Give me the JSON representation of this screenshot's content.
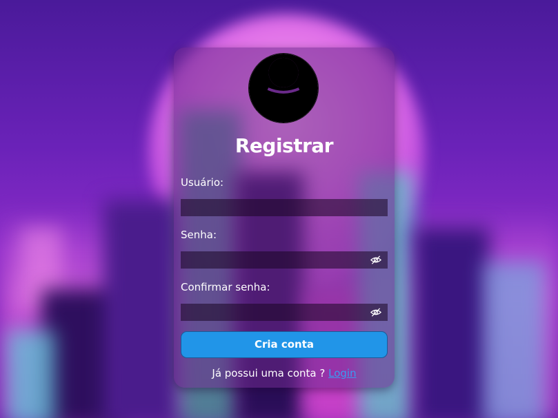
{
  "form": {
    "title": "Registrar",
    "username_label": "Usuário:",
    "username_value": "",
    "password_label": "Senha:",
    "password_value": "",
    "confirm_label": "Confirmar senha:",
    "confirm_value": "",
    "submit_label": "Cria conta",
    "footer_text": "Já possui uma conta ? ",
    "login_link": "Login",
    "toggle_icon": "eye-slash-icon",
    "avatar_icon": "user-icon"
  },
  "colors": {
    "button": "#2195e8",
    "link": "#3a9cf0",
    "title": "#ffffff"
  }
}
